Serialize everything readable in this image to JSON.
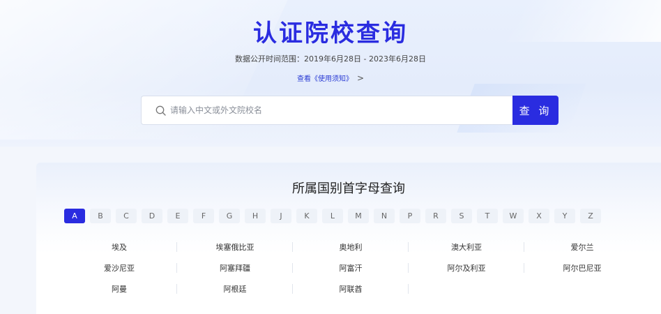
{
  "header": {
    "title": "认证院校查询",
    "date_range": "数据公开时间范围：2019年6月28日 - 2023年6月28日",
    "notice_link": "查看《使用须知》",
    "notice_chevron": ">"
  },
  "search": {
    "placeholder": "请输入中文或外文院校名",
    "value": "",
    "button_label": "查 询",
    "icon": "search-icon"
  },
  "filter": {
    "title": "所属国别首字母查询",
    "letters": [
      "A",
      "B",
      "C",
      "D",
      "E",
      "F",
      "G",
      "H",
      "J",
      "K",
      "L",
      "M",
      "N",
      "P",
      "R",
      "S",
      "T",
      "W",
      "X",
      "Y",
      "Z"
    ],
    "selected": "A"
  },
  "countries": [
    [
      "埃及",
      "埃塞俄比亚",
      "奥地利",
      "澳大利亚",
      "爱尔兰"
    ],
    [
      "爱沙尼亚",
      "阿塞拜疆",
      "阿富汗",
      "阿尔及利亚",
      "阿尔巴尼亚"
    ],
    [
      "阿曼",
      "阿根廷",
      "阿联酋"
    ]
  ],
  "colors": {
    "accent": "#2a2ce0",
    "title": "#2a2ce0",
    "letter_bg": "#eef2f8"
  }
}
